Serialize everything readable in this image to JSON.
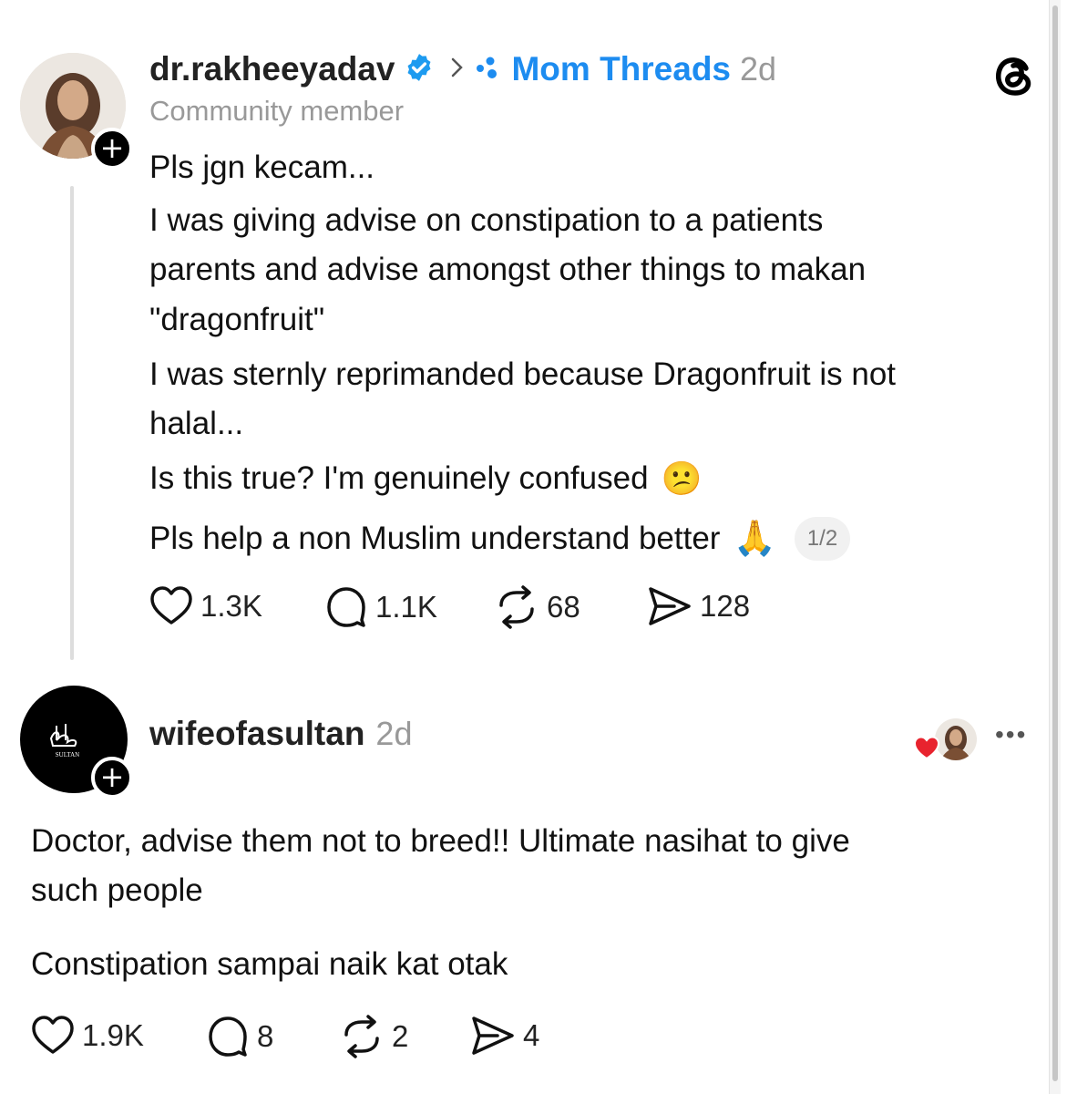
{
  "post": {
    "username": "dr.rakheeyadav",
    "community": "Mom Threads",
    "time": "2d",
    "subtitle": "Community member",
    "lines": [
      "Pls jgn kecam...",
      "I was giving advise on constipation to a patients",
      "parents and advise amongst other things to makan",
      "\"dragonfruit\"",
      "I was sternly reprimanded because Dragonfruit is not",
      "halal...",
      "Is this true? I'm genuinely confused",
      "Pls help a non Muslim understand better"
    ],
    "emoji_confused": "😕",
    "emoji_pray": "🙏",
    "page_indicator": "1/2",
    "likes": "1.3K",
    "replies": "1.1K",
    "reposts": "68",
    "shares": "128"
  },
  "reply": {
    "username": "wifeofasultan",
    "time": "2d",
    "avatar_text": "SULTAN",
    "lines": [
      "Doctor, advise them not to breed!! Ultimate nasihat to give",
      "such people",
      "Constipation sampai naik kat otak"
    ],
    "likes": "1.9K",
    "replies": "8",
    "reposts": "2",
    "shares": "4",
    "more_label": "•••"
  },
  "colors": {
    "accent": "#1d8cf0",
    "verified": "#1d9bf0",
    "heart": "#e8232e"
  },
  "icons": [
    "verified-icon",
    "chevron-right-icon",
    "community-icon",
    "threads-logo-icon",
    "heart-icon",
    "comment-icon",
    "repost-icon",
    "share-icon",
    "more-icon"
  ]
}
